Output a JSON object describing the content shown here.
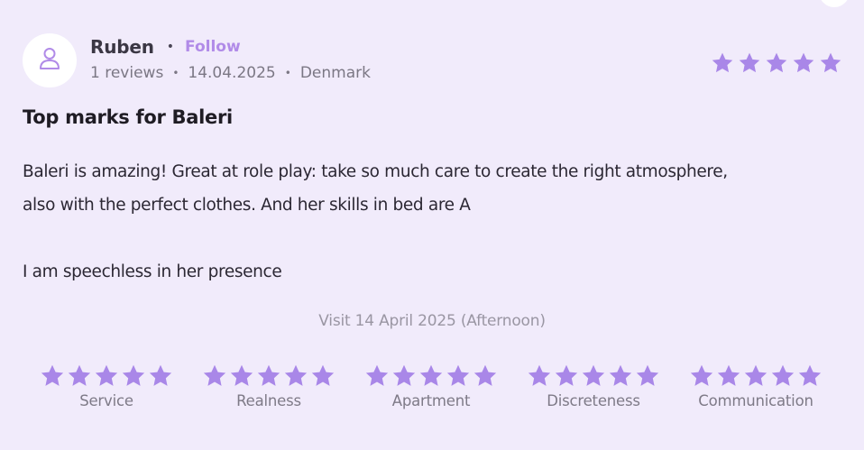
{
  "reviewer": {
    "name": "Ruben",
    "follow_label": "Follow",
    "reviews_count": "1 reviews",
    "date": "14.04.2025",
    "country": "Denmark",
    "avatar_icon": "user-icon"
  },
  "rating": {
    "overall": 5,
    "max": 5,
    "star_color": "#a987e8"
  },
  "review": {
    "title": "Top marks for Baleri",
    "body_line1": "Baleri is amazing! Great at role play: take so much care to create the right atmosphere,",
    "body_line2": "also with the perfect clothes. And her skills in bed are A",
    "body_line3": "I am speechless in her presence"
  },
  "visit": {
    "text": "Visit 14 April 2025 (Afternoon)"
  },
  "categories": [
    {
      "label": "Service",
      "rating": 5
    },
    {
      "label": "Realness",
      "rating": 5
    },
    {
      "label": "Apartment",
      "rating": 5
    },
    {
      "label": "Discreteness",
      "rating": 5
    },
    {
      "label": "Communication",
      "rating": 5
    }
  ],
  "colors": {
    "background": "#f1ebfb",
    "accent": "#b18be8"
  }
}
